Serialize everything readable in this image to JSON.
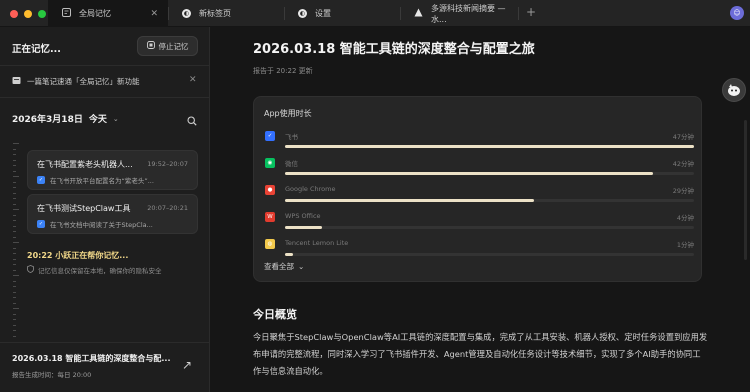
{
  "window": {
    "traffic_lights": [
      "#ff5f57",
      "#febc2e",
      "#28c840"
    ],
    "tabs": [
      {
        "label": "全局记忆",
        "active": true,
        "icon": "memory-icon"
      },
      {
        "label": "新标签页",
        "active": false,
        "icon": "browser-icon"
      },
      {
        "label": "设置",
        "active": false,
        "icon": "settings-icon"
      },
      {
        "label": "多源科技新闻摘要 — 水...",
        "active": false,
        "icon": "triangle-logo-icon"
      }
    ],
    "new_tab": "+"
  },
  "sidebar": {
    "title": "正在记忆...",
    "stop_button": "停止记忆",
    "banner": {
      "text": "一篇笔记速通「全局记忆」新功能"
    },
    "date": {
      "label": "2026年3月18日",
      "day": "今天"
    },
    "cards": [
      {
        "title": "在飞书配置紫老头机器人...",
        "time": "19:52–20:07",
        "summary": "在飞书开放平台配置名为“紫老头”..."
      },
      {
        "title": "在飞书测试StepClaw工具",
        "time": "20:07–20:21",
        "summary": "在飞书文档中阅读了关于StepCla..."
      }
    ],
    "now": {
      "title": "20:22 小跃正在帮你记忆...",
      "note": "记忆信息仅保留在本地，确保你的隐私安全"
    },
    "footer": {
      "title": "2026.03.18 智能工具链的深度整合与配...",
      "subtitle": "报告生成时间：每日 20:00"
    }
  },
  "report": {
    "title": "2026.03.18 智能工具链的深度整合与配置之旅",
    "meta": "报告于 20:22 更新",
    "usage": {
      "heading": "App使用时长",
      "see_all": "查看全部",
      "apps": [
        {
          "name": "飞书",
          "duration": "47分钟",
          "fraction": 1.0,
          "color": "#3370ff",
          "icon": "feishu-icon"
        },
        {
          "name": "微信",
          "duration": "42分钟",
          "fraction": 0.9,
          "color": "#07c160",
          "icon": "wechat-icon"
        },
        {
          "name": "Google Chrome",
          "duration": "29分钟",
          "fraction": 0.61,
          "color": "#ea4335",
          "icon": "chrome-icon"
        },
        {
          "name": "WPS Office",
          "duration": "4分钟",
          "fraction": 0.09,
          "color": "#e23b2e",
          "icon": "wps-icon"
        },
        {
          "name": "Tencent Lemon Lite",
          "duration": "1分钟",
          "fraction": 0.02,
          "color": "#f2c94c",
          "icon": "lemon-icon"
        }
      ]
    },
    "overview": {
      "title": "今日概览",
      "text": "今日聚焦于StepClaw与OpenClaw等AI工具链的深度配置与集成，完成了从工具安装、机器人授权、定时任务设置到应用发布申请的完整流程，同时深入学习了飞书插件开发、Agent管理及自动化任务设计等技术细节，实现了多个AI助手的协同工作与信息流自动化。"
    }
  }
}
